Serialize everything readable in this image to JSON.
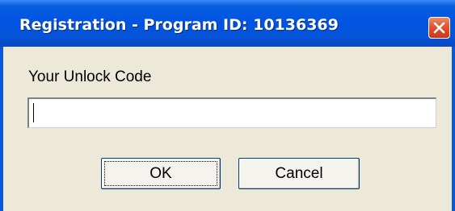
{
  "window": {
    "title": "Registration - Program ID: 10136369",
    "close_icon": "close-icon"
  },
  "form": {
    "label": "Your Unlock Code",
    "unlock_code_value": ""
  },
  "buttons": {
    "ok_label": "OK",
    "cancel_label": "Cancel"
  },
  "colors": {
    "titlebar": "#0054e3",
    "close_button": "#e2532d",
    "dialog_background": "#ece9d8"
  }
}
